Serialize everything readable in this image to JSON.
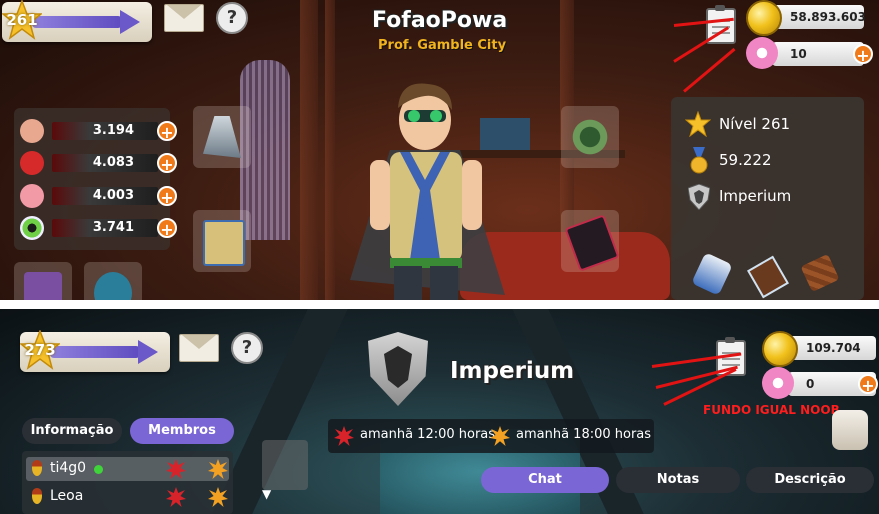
{
  "top": {
    "level": "261",
    "player_name": "FofaoPowa",
    "city": "Prof. Gamble City",
    "coins": "58.893.603",
    "donuts": "10",
    "stats": [
      {
        "icon": "muscle-icon",
        "value": "3.194",
        "color": "#e8a890"
      },
      {
        "icon": "helmet-icon",
        "value": "4.083",
        "color": "#d62a2a"
      },
      {
        "icon": "brain-icon",
        "value": "4.003",
        "color": "#f29aa6"
      },
      {
        "icon": "eye-icon",
        "value": "3.741",
        "color": "#6fcf46"
      }
    ],
    "info": {
      "level_label": "Nível 261",
      "medals": "59.222",
      "gang": "Imperium"
    }
  },
  "bottom": {
    "level": "273",
    "gang_name": "Imperium",
    "coins": "109.704",
    "donuts": "0",
    "note": "FUNDO IGUAL NOOB",
    "tabs": {
      "info": "Informação",
      "members": "Membros",
      "chat": "Chat",
      "notes": "Notas",
      "description": "Descrição"
    },
    "events": {
      "first": "amanhã 12:00 horas",
      "second": "amanhã 18:00 horas"
    },
    "members": [
      {
        "name": "ti4g0",
        "online": true
      },
      {
        "name": "Leoa",
        "online": false
      }
    ]
  },
  "colors": {
    "plus": "#f07a1a",
    "annotation_red": "#e21313",
    "city_gold": "#f2b41d",
    "tab_purple": "#7b66d6"
  }
}
